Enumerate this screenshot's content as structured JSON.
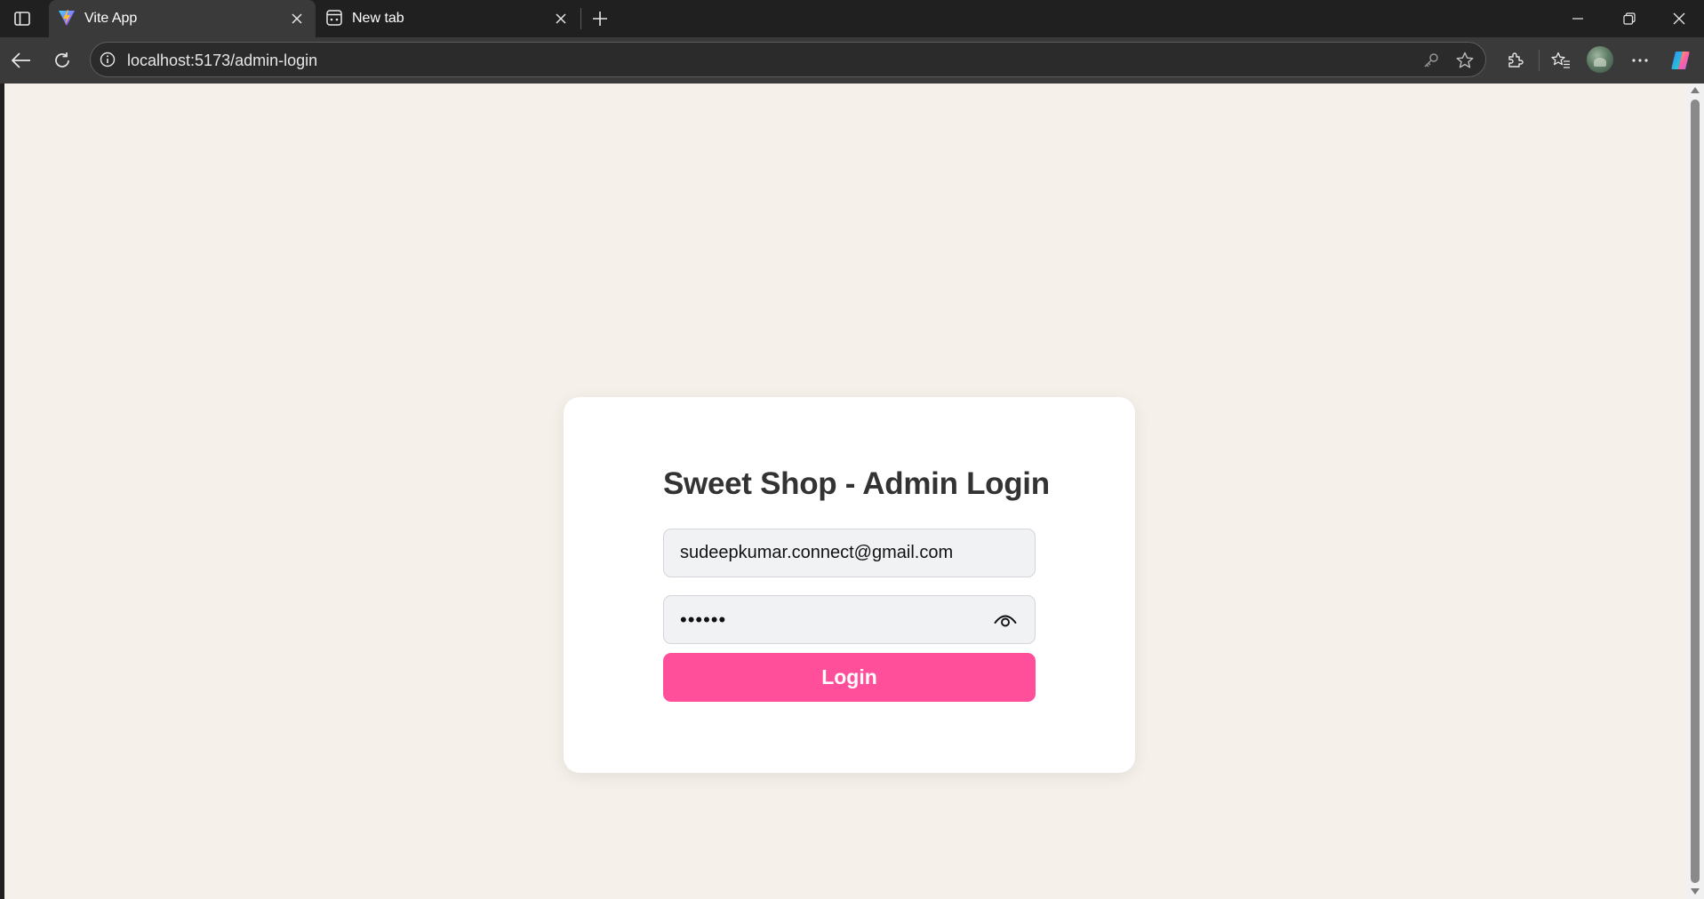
{
  "browser": {
    "tabs": [
      {
        "title": "Vite App",
        "favicon": "vite-logo-icon",
        "active": true
      },
      {
        "title": "New tab",
        "favicon": "new-tab-page-icon",
        "active": false
      }
    ],
    "url": "localhost:5173/admin-login",
    "accent_color": "#3a3a3a"
  },
  "login": {
    "title": "Sweet Shop - Admin Login",
    "email_value": "sudeepkumar.connect@gmail.com",
    "password_value": "123456",
    "login_label": "Login",
    "password_toggle_icon": "eye-icon",
    "button_color": "#ff4f9b",
    "page_background": "#f5f0ea"
  }
}
